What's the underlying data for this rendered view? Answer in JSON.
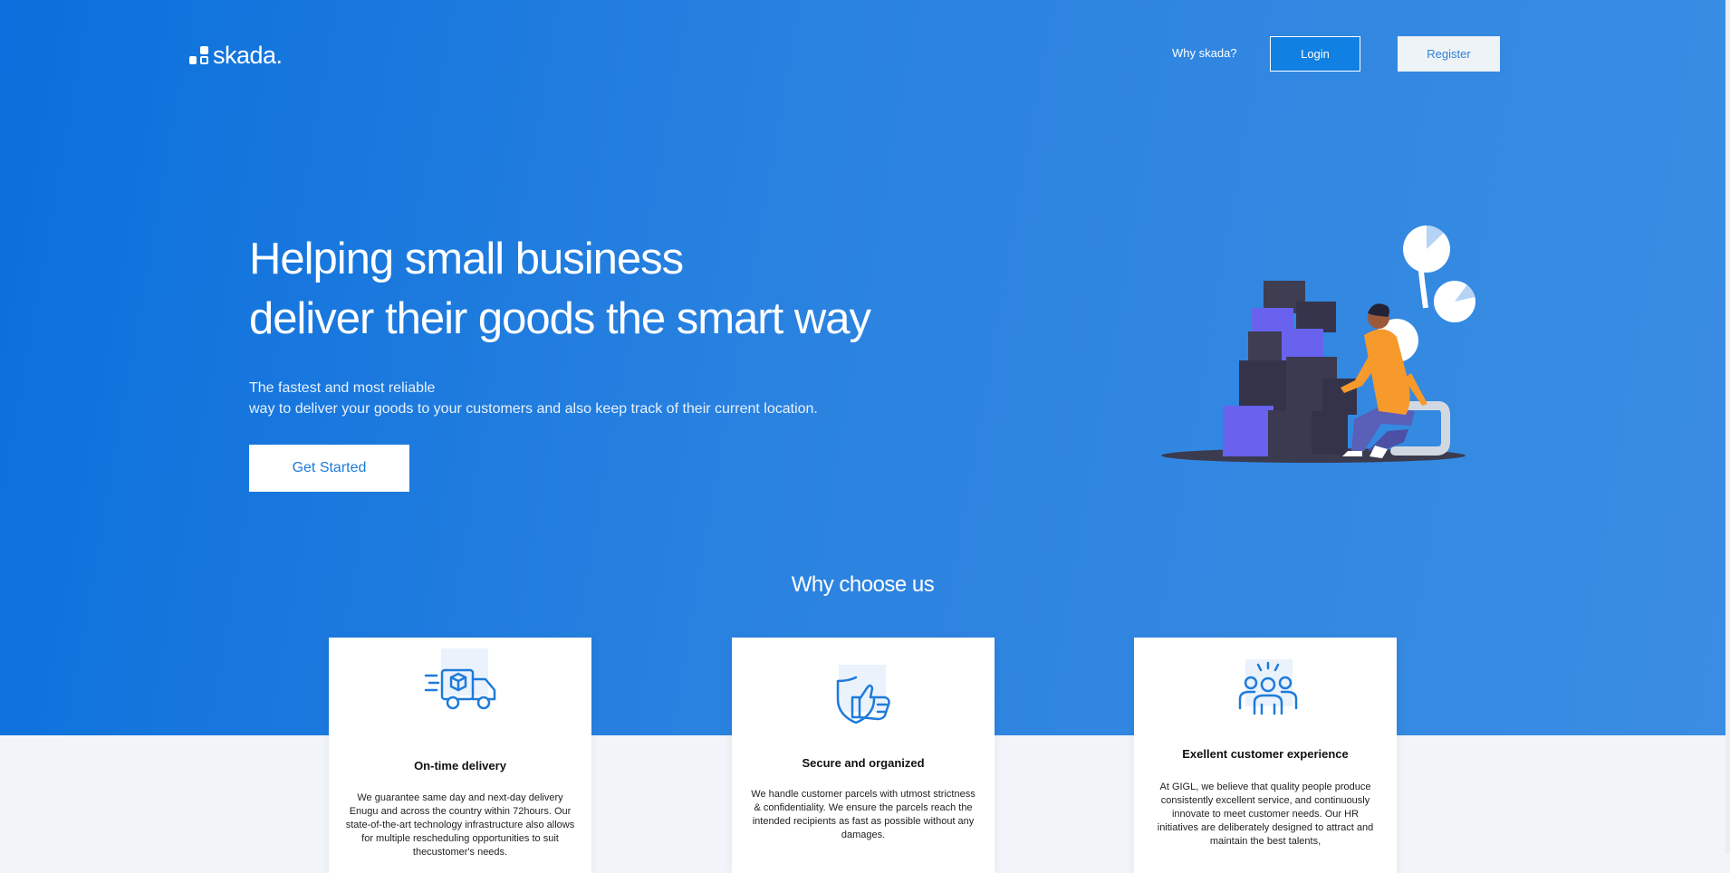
{
  "header": {
    "logo_text": "skada.",
    "nav_why": "Why skada?",
    "login_label": "Login",
    "register_label": "Register"
  },
  "hero": {
    "headline_line1": "Helping small business",
    "headline_line2": "deliver their goods the smart way",
    "sub_line1": "The fastest and most reliable",
    "sub_line2": "way to deliver your goods to your customers and also keep track of their current location.",
    "cta_label": "Get Started",
    "illustration_icon": "delivery-person-boxes-illustration"
  },
  "why": {
    "title": "Why choose us",
    "cards": [
      {
        "icon": "delivery-truck-icon",
        "title": "On-time delivery",
        "text": "We guarantee same day and next-day delivery Enugu and across the country within 72hours. Our state-of-the-art technology infrastructure also allows for multiple rescheduling opportunities to suit thecustomer's needs."
      },
      {
        "icon": "thumbs-up-shield-icon",
        "title": "Secure and organized",
        "text": "We handle customer parcels with utmost strictness & confidentiality. We ensure the parcels reach the intended recipients as fast as possible without any damages."
      },
      {
        "icon": "team-people-icon",
        "title": "Exellent customer experience",
        "text": "At GIGL, we believe that quality people produce consistently excellent service, and continuously innovate to meet customer needs. Our HR initiatives are deliberately designed to attract and maintain the best talents,"
      }
    ]
  },
  "colors": {
    "hero_gradient_start": "#0a6fdc",
    "hero_gradient_end": "#3a8de2",
    "accent": "#1f7bd9",
    "page_bg": "#f1f5f9"
  }
}
